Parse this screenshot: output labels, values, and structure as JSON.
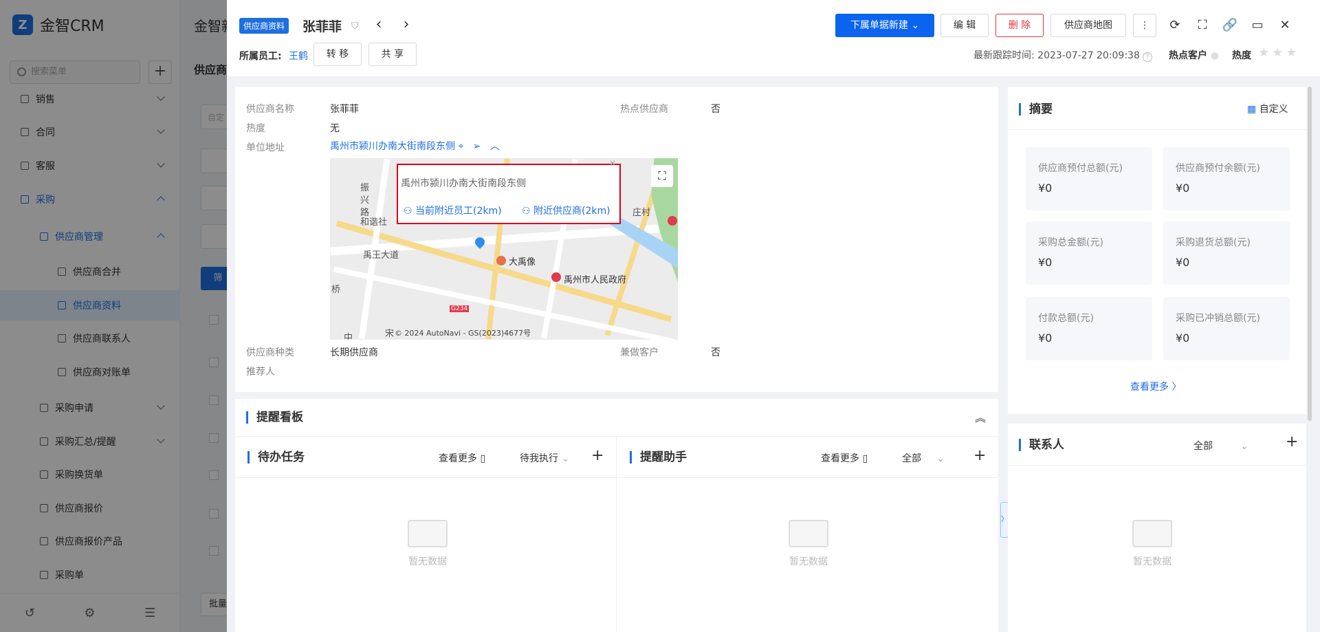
{
  "app": {
    "brand": "金智CRM",
    "bg_title": "金智新",
    "bg_crumb": "供应商",
    "filter_btn": "筛",
    "input_placeholder": "自定",
    "batch_btn": "批量"
  },
  "sidebar": {
    "search_placeholder": "搜索菜单",
    "items": [
      {
        "label": "销售"
      },
      {
        "label": "合同"
      },
      {
        "label": "客服"
      },
      {
        "label": "采购"
      },
      {
        "label": "供应商管理"
      },
      {
        "label": "供应商合并"
      },
      {
        "label": "供应商资料"
      },
      {
        "label": "供应商联系人"
      },
      {
        "label": "供应商对账单"
      },
      {
        "label": "采购申请"
      },
      {
        "label": "采购汇总/提醒"
      },
      {
        "label": "采购换货单"
      },
      {
        "label": "供应商报价"
      },
      {
        "label": "供应商报价产品"
      },
      {
        "label": "采购单"
      }
    ]
  },
  "header": {
    "badge": "供应商资料",
    "record_name": "张菲菲",
    "owner_label": "所属员工:",
    "owner_name": "王鹤",
    "transfer_btn": "转 移",
    "share_btn": "共 享",
    "new_sub_btn": "下属单据新建",
    "edit_btn": "编 辑",
    "delete_btn": "删 除",
    "map_btn": "供应商地图",
    "track_label": "最新跟踪时间:",
    "track_time": "2023-07-27 20:09:38",
    "hot_customer": "热点客户",
    "heat_label": "热度"
  },
  "info": {
    "fields": [
      {
        "label": "供应商名称",
        "value": "张菲菲"
      },
      {
        "label": "热点供应商",
        "value": "否"
      },
      {
        "label": "热度",
        "value": "无"
      },
      {
        "label": "单位地址",
        "value": "禹州市颍川办南大街南段东侧"
      },
      {
        "label": "供应商种类",
        "value": "长期供应商"
      },
      {
        "label": "兼做客户",
        "value": "否"
      },
      {
        "label": "推荐人",
        "value": ""
      }
    ],
    "map": {
      "popup_address": "禹州市颍川办南大街南段东侧",
      "nearby_staff": "当前附近员工(2km)",
      "nearby_supplier": "附近供应商(2km)",
      "labels": [
        "振",
        "兴",
        "路",
        "和谐社",
        "禹王大道",
        "大禹像",
        "禹州市人民政府",
        "庄村",
        "桥",
        "宋",
        "中",
        "G234"
      ],
      "copyright": "© 2024 AutoNavi - GS(2023)4677号"
    }
  },
  "summary": {
    "title": "摘要",
    "customize": "自定义",
    "stats": [
      {
        "label": "供应商预付总额(元)",
        "value": "¥0"
      },
      {
        "label": "供应商预付余额(元)",
        "value": "¥0"
      },
      {
        "label": "采购总金额(元)",
        "value": "¥0"
      },
      {
        "label": "采购退货总额(元)",
        "value": "¥0"
      },
      {
        "label": "付款总额(元)",
        "value": "¥0"
      },
      {
        "label": "采购已冲销总额(元)",
        "value": "¥0"
      }
    ],
    "more": "查看更多"
  },
  "contacts": {
    "title": "联系人",
    "filter": "全部",
    "empty": "暂无数据"
  },
  "reminder": {
    "title": "提醒看板",
    "todo": {
      "title": "待办任务",
      "more": "查看更多",
      "filter": "待我执行",
      "empty": "暂无数据"
    },
    "assistant": {
      "title": "提醒助手",
      "more": "查看更多",
      "filter": "全部",
      "empty": "暂无数据"
    }
  }
}
